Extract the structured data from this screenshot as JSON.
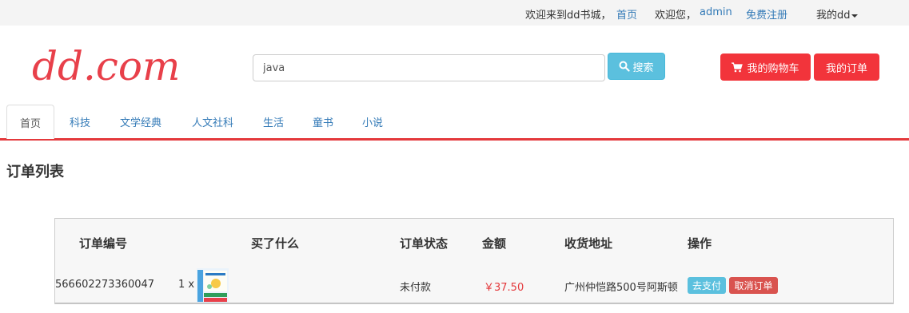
{
  "topbar": {
    "welcome": "欢迎来到dd书城，",
    "home_link": "首页",
    "greeting": "欢迎您，",
    "username": "admin",
    "register": "免费注册",
    "my_menu": "我的dd"
  },
  "header": {
    "logo_text": "dd.com",
    "search_value": "java",
    "search_button": "搜索",
    "cart_button": "我的购物车",
    "orders_button": "我的订单"
  },
  "nav": {
    "tabs": [
      "首页",
      "科技",
      "文学经典",
      "人文社科",
      "生活",
      "童书",
      "小说"
    ]
  },
  "page": {
    "title": "订单列表"
  },
  "orders": {
    "headers": [
      "订单编号",
      "买了什么",
      "订单状态",
      "金额",
      "收货地址",
      "操作"
    ],
    "rows": [
      {
        "order_no": "566602273360047",
        "qty": "1 x",
        "status": "未付款",
        "amount": "￥37.50",
        "address": "广州仲恺路500号阿斯顿",
        "pay": "去支付",
        "cancel": "取消订单"
      }
    ]
  },
  "colors": {
    "brand_red": "#f2343b",
    "info_blue": "#5bc0de",
    "danger": "#d9534f",
    "link": "#337ab7"
  }
}
